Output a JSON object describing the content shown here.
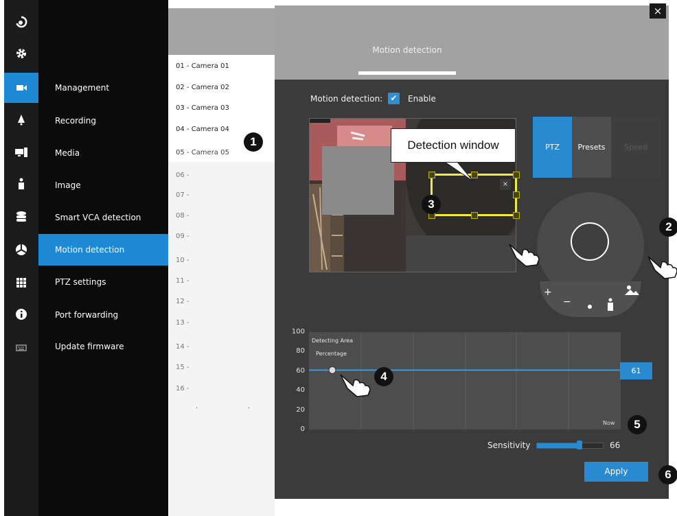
{
  "menu": {
    "items": [
      {
        "label": "Management"
      },
      {
        "label": "Recording"
      },
      {
        "label": "Media"
      },
      {
        "label": "Image"
      },
      {
        "label": "Smart VCA detection"
      },
      {
        "label": "Motion detection"
      },
      {
        "label": "PTZ settings"
      },
      {
        "label": "Port forwarding"
      },
      {
        "label": "Update firmware"
      }
    ]
  },
  "cameras": {
    "items": [
      {
        "label": "01 - Camera 01"
      },
      {
        "label": "02 - Camera 02"
      },
      {
        "label": "03 - Camera 03"
      },
      {
        "label": "04 - Camera 04"
      },
      {
        "label": "05 - Camera 05"
      },
      {
        "label": "06 -"
      },
      {
        "label": "07 -"
      },
      {
        "label": "08 -"
      },
      {
        "label": "09 -"
      },
      {
        "label": "10 -"
      },
      {
        "label": "11 -"
      },
      {
        "label": "12 -"
      },
      {
        "label": "13 -"
      },
      {
        "label": "14 -"
      },
      {
        "label": "15 -"
      },
      {
        "label": "16 -"
      }
    ],
    "pager_dots": [
      ".",
      "."
    ]
  },
  "panel": {
    "title": "Motion detection",
    "close_label": "×",
    "md_label": "Motion detection:",
    "md_enabled": true,
    "md_check": "✔",
    "md_enable_label": "Enable",
    "detection_window_close": "×"
  },
  "ptz": {
    "tabs": [
      {
        "label": "PTZ"
      },
      {
        "label": "Presets"
      },
      {
        "label": "Speed"
      }
    ],
    "buttons": {
      "zoom_in": "+",
      "zoom_out": "−"
    }
  },
  "chart_data": {
    "type": "line",
    "title": "",
    "labels": [
      "Detecting Area",
      "Percentage"
    ],
    "y_ticks": [
      "100",
      "80",
      "60",
      "40",
      "20",
      "0"
    ],
    "ylim": [
      0,
      100
    ],
    "threshold": 61,
    "threshold_label": "61",
    "x_end_label": "Now",
    "grid": true
  },
  "sensitivity": {
    "label": "Sensitivity",
    "value": 66,
    "value_label": "66"
  },
  "apply_label": "Apply",
  "callouts": {
    "detection_window": "Detection window",
    "numbers": [
      "1",
      "2",
      "3",
      "4",
      "5",
      "6"
    ]
  },
  "colors": {
    "accent": "#2a8ad0",
    "detection_window": "#f0ec3c",
    "panel": "#3b3b3b"
  }
}
